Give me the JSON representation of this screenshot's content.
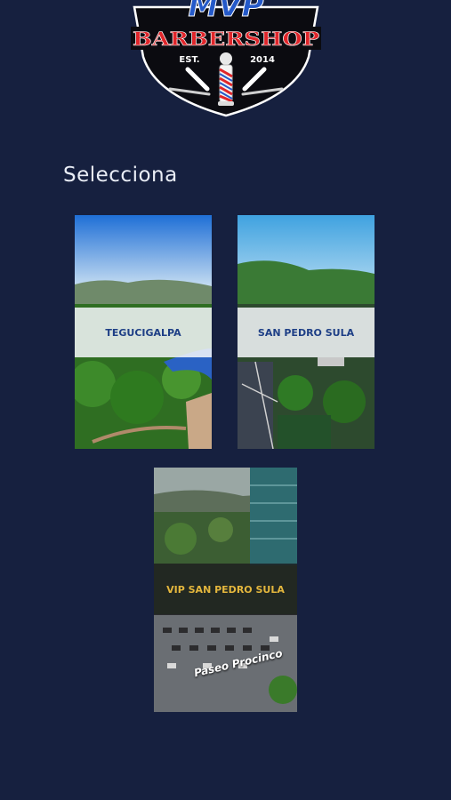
{
  "logo": {
    "name": "MVP",
    "title": "BARBERSHOP",
    "est_label": "EST.",
    "year": "2014"
  },
  "prompt": "Selecciona",
  "locations": [
    {
      "label": "TEGUCIGALPA"
    },
    {
      "label": "SAN PEDRO SULA"
    },
    {
      "label": "VIP SAN PEDRO SULA",
      "watermark": "Paseo Procinco"
    }
  ],
  "colors": {
    "background": "#16203f",
    "label_blue": "#1e3f86",
    "label_gold": "#e3b63d",
    "logo_red": "#e0262b",
    "logo_blue": "#2459c9"
  }
}
